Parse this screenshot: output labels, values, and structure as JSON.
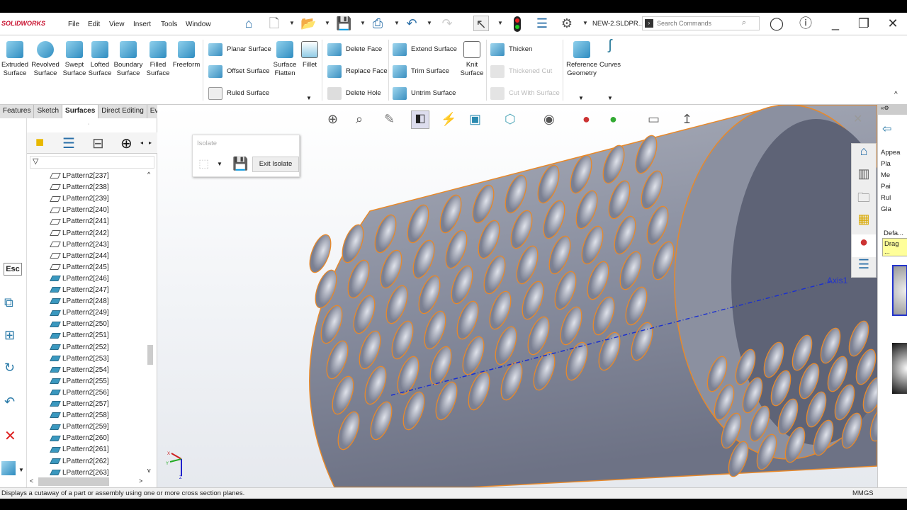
{
  "app": {
    "logo": "SOLIDWORKS",
    "document": "NEW-2.SLDPR...",
    "search_placeholder": "Search Commands"
  },
  "menu": [
    "File",
    "Edit",
    "View",
    "Insert",
    "Tools",
    "Window"
  ],
  "ribbon": {
    "big": [
      "Extruded Surface",
      "Revolved Surface",
      "Swept Surface",
      "Lofted Surface",
      "Boundary Surface",
      "Filled Surface",
      "Freeform"
    ],
    "col1": [
      "Planar Surface",
      "Offset Surface",
      "Ruled Surface"
    ],
    "mid_big": [
      "Surface Flatten",
      "Fillet"
    ],
    "col2": [
      "Delete Face",
      "Replace Face",
      "Delete Hole"
    ],
    "col3": [
      "Extend Surface",
      "Trim Surface",
      "Untrim Surface"
    ],
    "knit": "Knit Surface",
    "col4": [
      "Thicken",
      "Thickened Cut",
      "Cut With Surface"
    ],
    "end_big": [
      "Reference Geometry",
      "Curves"
    ]
  },
  "tabs": [
    "Features",
    "Sketch",
    "Surfaces",
    "Direct Editing",
    "Evaluate"
  ],
  "active_tab": "Surfaces",
  "tree": {
    "items": [
      {
        "label": "LPattern2[237]",
        "filled": false
      },
      {
        "label": "LPattern2[238]",
        "filled": false
      },
      {
        "label": "LPattern2[239]",
        "filled": false
      },
      {
        "label": "LPattern2[240]",
        "filled": false
      },
      {
        "label": "LPattern2[241]",
        "filled": false
      },
      {
        "label": "LPattern2[242]",
        "filled": false
      },
      {
        "label": "LPattern2[243]",
        "filled": false
      },
      {
        "label": "LPattern2[244]",
        "filled": false
      },
      {
        "label": "LPattern2[245]",
        "filled": false
      },
      {
        "label": "LPattern2[246]",
        "filled": true
      },
      {
        "label": "LPattern2[247]",
        "filled": true
      },
      {
        "label": "LPattern2[248]",
        "filled": true
      },
      {
        "label": "LPattern2[249]",
        "filled": true
      },
      {
        "label": "LPattern2[250]",
        "filled": true
      },
      {
        "label": "LPattern2[251]",
        "filled": true
      },
      {
        "label": "LPattern2[252]",
        "filled": true
      },
      {
        "label": "LPattern2[253]",
        "filled": true
      },
      {
        "label": "LPattern2[254]",
        "filled": true
      },
      {
        "label": "LPattern2[255]",
        "filled": true
      },
      {
        "label": "LPattern2[256]",
        "filled": true
      },
      {
        "label": "LPattern2[257]",
        "filled": true
      },
      {
        "label": "LPattern2[258]",
        "filled": true
      },
      {
        "label": "LPattern2[259]",
        "filled": true
      },
      {
        "label": "LPattern2[260]",
        "filled": true
      },
      {
        "label": "LPattern2[261]",
        "filled": true
      },
      {
        "label": "LPattern2[262]",
        "filled": true
      },
      {
        "label": "LPattern2[263]",
        "filled": true
      }
    ]
  },
  "left_toolbar": {
    "esc": "Esc"
  },
  "isolate": {
    "title": "Isolate",
    "exit": "Exit Isolate"
  },
  "viewport": {
    "axis_label": "Axis1",
    "triad": [
      "X",
      "Y",
      "Z"
    ]
  },
  "task_pane": {
    "items": [
      "Appea",
      "Pla",
      "Me",
      "Pai",
      "Rul",
      "Gla"
    ],
    "default": "Defa...",
    "drag": "Drag ..."
  },
  "status": {
    "message": "Displays a cutaway of a part or assembly using one or more cross section planes.",
    "units": "MMGS"
  },
  "colors": {
    "accent": "#2f8cc0",
    "edge": "#e8892a",
    "axis": "#1a2fd0"
  }
}
